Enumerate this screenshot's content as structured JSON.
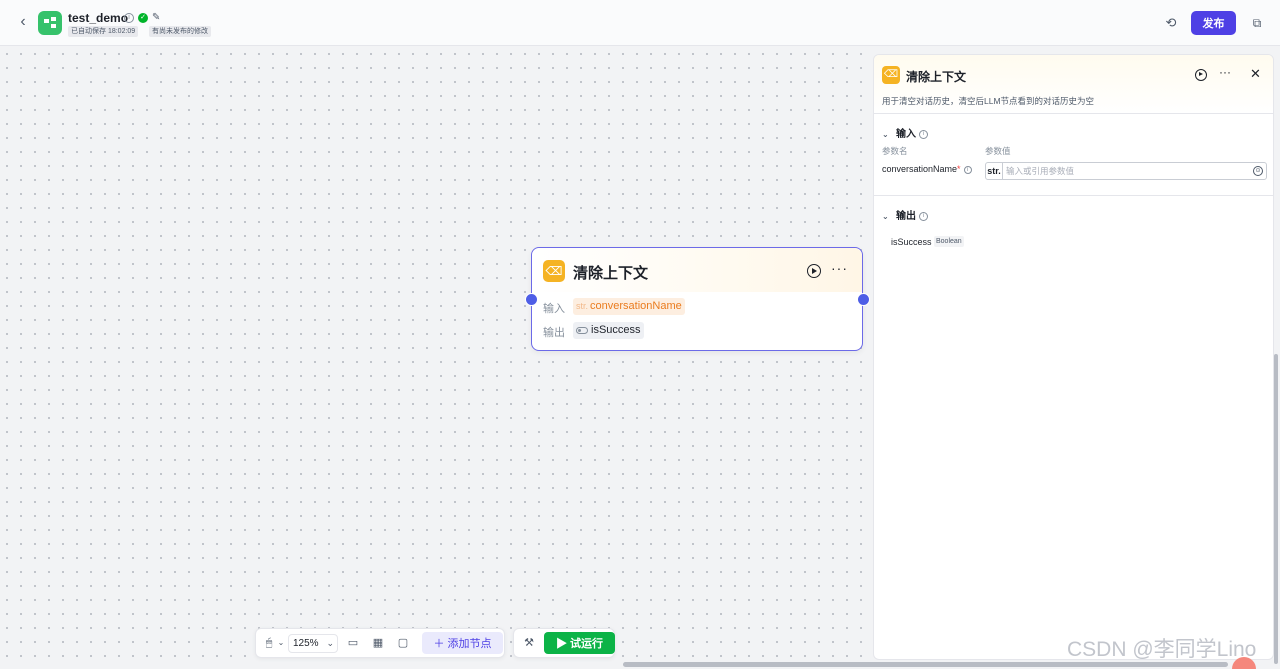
{
  "header": {
    "back_icon": "chevron-left-icon",
    "app_name": "test_demo",
    "autosave": "已自动保存 18:02:09",
    "unpublished": "有尚未发布的修改",
    "publish_label": "发布"
  },
  "node": {
    "title": "清除上下文",
    "input_label": "输入",
    "input_type": "str.",
    "input_param": "conversationName",
    "output_label": "输出",
    "output_param": "isSuccess"
  },
  "toolbar": {
    "zoom": "125%",
    "add_node_label": "添加节点",
    "trial_label": "试运行"
  },
  "panel": {
    "title": "清除上下文",
    "description": "用于清空对话历史，清空后LLM节点看到的对话历史为空",
    "input_section": "输入",
    "col_param_name": "参数名",
    "col_param_value": "参数值",
    "param_name": "conversationName",
    "param_required_mark": "*",
    "param_type": "str.",
    "param_placeholder": "输入或引用参数值",
    "output_section": "输出",
    "output_name": "isSuccess",
    "output_type": "Boolean"
  },
  "watermark": "CSDN @李同学Lino",
  "colors": {
    "accent": "#4e40e5",
    "node_border": "#6c6ae8",
    "trial_green": "#0cb347",
    "node_icon": "#f5b323"
  }
}
